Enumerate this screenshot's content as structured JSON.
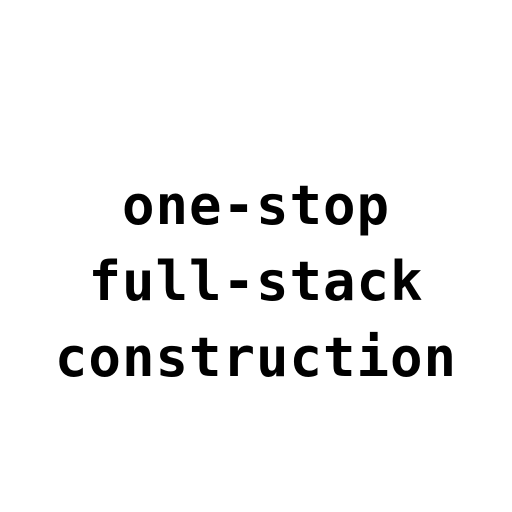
{
  "lines": [
    "one-stop",
    "full-stack",
    "construction"
  ],
  "colors": {
    "background": "#ffffff",
    "text": "#000000"
  }
}
